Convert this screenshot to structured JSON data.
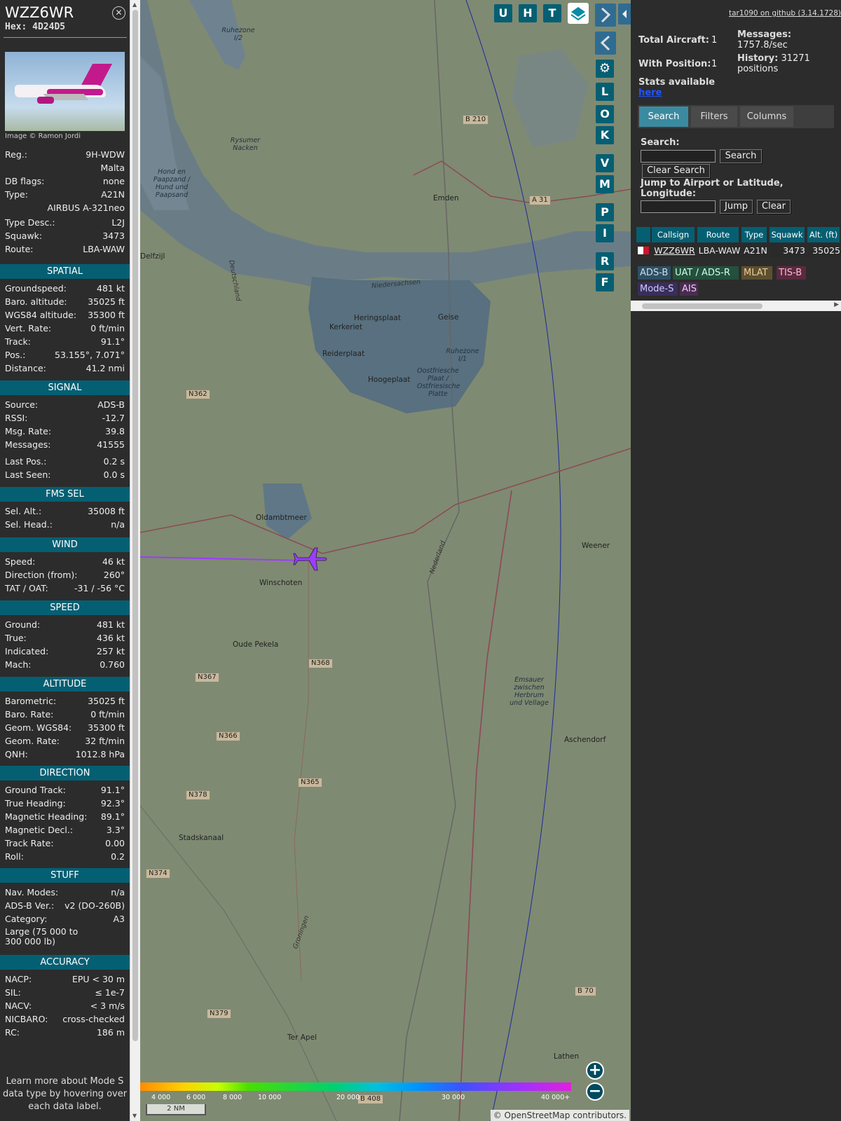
{
  "sidebar": {
    "callsign": "WZZ6WR",
    "hex": "Hex: 4D24D5",
    "photo_credit": "Image © Ramon Jordi",
    "info_rows": [
      {
        "label": "Reg.:",
        "value": "9H-WDW"
      },
      {
        "label": "",
        "value": "Malta"
      },
      {
        "label": "DB flags:",
        "value": "none"
      },
      {
        "label": "Type:",
        "value": "A21N"
      },
      {
        "label": "",
        "value": "AIRBUS A-321neo"
      },
      {
        "label": "Type Desc.:",
        "value": "L2J"
      },
      {
        "label": "Squawk:",
        "value": "3473"
      },
      {
        "label": "Route:",
        "value": "LBA-WAW"
      }
    ],
    "sections": {
      "spatial": {
        "title": "SPATIAL",
        "rows": [
          {
            "label": "Groundspeed:",
            "value": "481 kt"
          },
          {
            "label": "Baro. altitude:",
            "value": "35025 ft"
          },
          {
            "label": "WGS84 altitude:",
            "value": "35300 ft"
          },
          {
            "label": "Vert. Rate:",
            "value": "0 ft/min"
          },
          {
            "label": "Track:",
            "value": "91.1°"
          },
          {
            "label": "Pos.:",
            "value": "53.155°, 7.071°"
          },
          {
            "label": "Distance:",
            "value": "41.2 nmi"
          }
        ]
      },
      "signal": {
        "title": "SIGNAL",
        "rows": [
          {
            "label": "Source:",
            "value": "ADS-B"
          },
          {
            "label": "RSSI:",
            "value": "-12.7"
          },
          {
            "label": "Msg. Rate:",
            "value": "39.8"
          },
          {
            "label": "Messages:",
            "value": "41555"
          },
          {
            "label": "Last Pos.:",
            "value": "0.2 s"
          },
          {
            "label": "Last Seen:",
            "value": "0.0 s"
          }
        ]
      },
      "fms": {
        "title": "FMS SEL",
        "rows": [
          {
            "label": "Sel. Alt.:",
            "value": "35008 ft"
          },
          {
            "label": "Sel. Head.:",
            "value": "n/a"
          }
        ]
      },
      "wind": {
        "title": "WIND",
        "rows": [
          {
            "label": "Speed:",
            "value": "46 kt"
          },
          {
            "label": "Direction (from):",
            "value": "260°"
          },
          {
            "label": "TAT / OAT:",
            "value": "-31 / -56 °C"
          }
        ]
      },
      "speed": {
        "title": "SPEED",
        "rows": [
          {
            "label": "Ground:",
            "value": "481 kt"
          },
          {
            "label": "True:",
            "value": "436 kt"
          },
          {
            "label": "Indicated:",
            "value": "257 kt"
          },
          {
            "label": "Mach:",
            "value": "0.760"
          }
        ]
      },
      "altitude": {
        "title": "ALTITUDE",
        "rows": [
          {
            "label": "Barometric:",
            "value": "35025 ft"
          },
          {
            "label": "Baro. Rate:",
            "value": "0 ft/min"
          },
          {
            "label": "Geom. WGS84:",
            "value": "35300 ft"
          },
          {
            "label": "Geom. Rate:",
            "value": "32 ft/min"
          },
          {
            "label": "QNH:",
            "value": "1012.8 hPa"
          }
        ]
      },
      "direction": {
        "title": "DIRECTION",
        "rows": [
          {
            "label": "Ground Track:",
            "value": "91.1°"
          },
          {
            "label": "True Heading:",
            "value": "92.3°"
          },
          {
            "label": "Magnetic Heading:",
            "value": "89.1°"
          },
          {
            "label": "Magnetic Decl.:",
            "value": "3.3°"
          },
          {
            "label": "Track Rate:",
            "value": "0.00"
          },
          {
            "label": "Roll:",
            "value": "0.2"
          }
        ]
      },
      "stuff": {
        "title": "STUFF",
        "rows": [
          {
            "label": "Nav. Modes:",
            "value": "n/a"
          },
          {
            "label": "ADS-B Ver.:",
            "value": "v2 (DO-260B)"
          },
          {
            "label": "Category:",
            "value": "A3"
          }
        ],
        "category_desc_1": "Large (75 000 to",
        "category_desc_2": "300 000 lb)"
      },
      "accuracy": {
        "title": "ACCURACY",
        "rows": [
          {
            "label": "NACP:",
            "value": "EPU < 30 m"
          },
          {
            "label": "SIL:",
            "value": "≤ 1e-7"
          },
          {
            "label": "NACV:",
            "value": "< 3 m/s"
          },
          {
            "label": "NICBARO:",
            "value": "cross-checked"
          },
          {
            "label": "RC:",
            "value": "186 m"
          }
        ]
      }
    },
    "learn_more": "Learn more about Mode S data type by hovering over each data label."
  },
  "map": {
    "controls": [
      "U",
      "H",
      "T"
    ],
    "side_buttons": [
      "L",
      "O",
      "K",
      "V",
      "M",
      "P",
      "I",
      "R",
      "F"
    ],
    "place_labels": [
      "Emden",
      "Delfzijl",
      "Weener",
      "Winschoten",
      "Oude Pekela",
      "Aschendorf",
      "Stadskanaal",
      "Ter Apel",
      "Lathen",
      "Rysumer Nacken",
      "Hond en Paapzand / Hund und Paapsand",
      "Heringsplaat",
      "Kerkeriet",
      "Reiderplaat",
      "Geise",
      "Hoogeplaat",
      "Oldambtmeer",
      "Ruhezone I/1",
      "Ruhezone I/2",
      "Oostfriesche Plaat / Ostfriesische Platte",
      "Emsauer zwischen Herbrum und Vellage",
      "Niedersachsen",
      "Deutschland",
      "Nederland",
      "Groningen"
    ],
    "road_labels": [
      "B 210",
      "A 31",
      "N362",
      "N368",
      "N367",
      "N366",
      "N365",
      "N378",
      "N374",
      "N379",
      "B 70",
      "B 408"
    ],
    "colorbar_labels": [
      "4 000",
      "6 000",
      "8 000",
      "10 000",
      "20 000",
      "30 000",
      "40 000+"
    ],
    "scale": "2 NM",
    "attribution": "© OpenStreetMap contributors.",
    "zoom_in": "+",
    "zoom_out": "−"
  },
  "right": {
    "github": "tar1090 on github (3.14.1728)",
    "total_aircraft_label": "Total Aircraft:",
    "total_aircraft": "1",
    "with_position_label": "With Position:",
    "with_position": "1",
    "messages_label": "Messages:",
    "messages_value": "1757.8/sec",
    "history_label": "History:",
    "history_value": "31271",
    "history_unit": "positions",
    "stats_label": "Stats available",
    "stats_link": "here",
    "tabs": [
      "Search",
      "Filters",
      "Columns"
    ],
    "search_label": "Search:",
    "search_button": "Search",
    "clear_search_button": "Clear Search",
    "jump_label": "Jump to Airport or Latitude, Longitude:",
    "jump_button": "Jump",
    "clear_button": "Clear",
    "table_headers": [
      "",
      "Callsign",
      "Route",
      "Type",
      "Squawk",
      "Alt. (ft)"
    ],
    "table_row": {
      "callsign": "WZZ6WR",
      "route": "LBA-WAW",
      "type": "A21N",
      "squawk": "3473",
      "alt": "35025"
    },
    "badges": [
      "ADS-B",
      "UAT / ADS-R",
      "MLAT",
      "TIS-B",
      "Mode-S",
      "AIS"
    ]
  }
}
